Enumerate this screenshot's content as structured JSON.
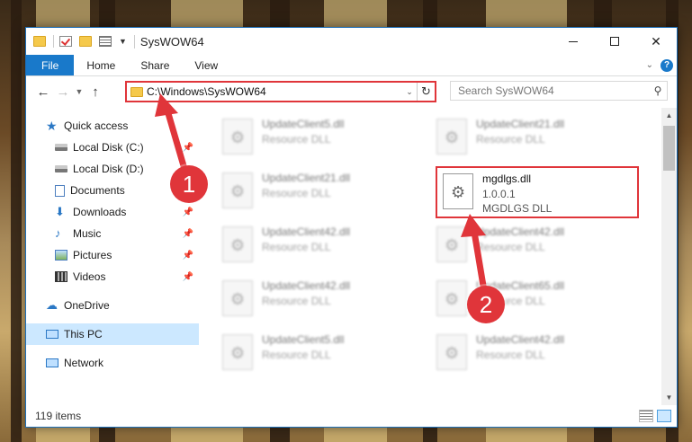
{
  "window": {
    "title": "SysWOW64"
  },
  "ribbon": {
    "tabs": [
      {
        "label": "File"
      },
      {
        "label": "Home"
      },
      {
        "label": "Share"
      },
      {
        "label": "View"
      }
    ],
    "help": "?"
  },
  "address": {
    "path": "C:\\Windows\\SysWOW64",
    "search_placeholder": "Search SysWOW64"
  },
  "sidebar": {
    "items": [
      {
        "label": "Quick access"
      },
      {
        "label": "Local Disk (C:)"
      },
      {
        "label": "Local Disk (D:)"
      },
      {
        "label": "Documents"
      },
      {
        "label": "Downloads"
      },
      {
        "label": "Music"
      },
      {
        "label": "Pictures"
      },
      {
        "label": "Videos"
      },
      {
        "label": "OneDrive"
      },
      {
        "label": "This PC"
      },
      {
        "label": "Network"
      }
    ]
  },
  "files": [
    {
      "name": "UpdateClient5.dll",
      "desc": "Resource DLL"
    },
    {
      "name": "UpdateClient21.dll",
      "desc": "Resource DLL"
    },
    {
      "name": "UpdateClient21.dll",
      "desc": "Resource DLL"
    },
    {
      "name": "mgdlgs.dll",
      "version": "1.0.0.1",
      "desc": "MGDLGS DLL"
    },
    {
      "name": "UpdateClient42.dll",
      "desc": "Resource DLL"
    },
    {
      "name": "UpdateClient42.dll",
      "desc": "Resource DLL"
    },
    {
      "name": "UpdateClient42.dll",
      "desc": "Resource DLL"
    },
    {
      "name": "UpdateClient65.dll",
      "desc": "Resource DLL"
    },
    {
      "name": "UpdateClient5.dll",
      "desc": "Resource DLL"
    },
    {
      "name": "UpdateClient42.dll",
      "desc": "Resource DLL"
    }
  ],
  "status": {
    "count": "119 items"
  },
  "callouts": {
    "one": "1",
    "two": "2"
  },
  "colors": {
    "accent": "#1979ca",
    "highlight": "#e0353a",
    "selected_nav": "#cce8ff"
  }
}
